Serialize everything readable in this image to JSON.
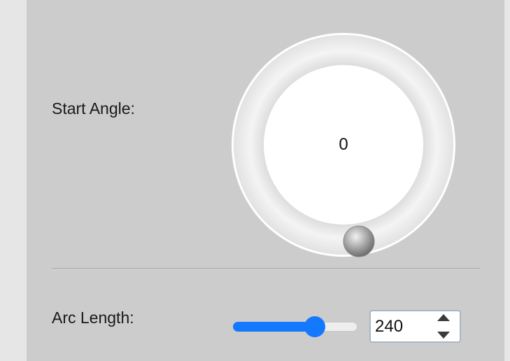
{
  "start_angle": {
    "label": "Start Angle:",
    "value": "0",
    "angle_degrees": 0
  },
  "arc_length": {
    "label": "Arc Length:",
    "value": "240",
    "slider_fraction": 0.66
  },
  "colors": {
    "panel": "#cccccc",
    "accent": "#1479ff"
  }
}
